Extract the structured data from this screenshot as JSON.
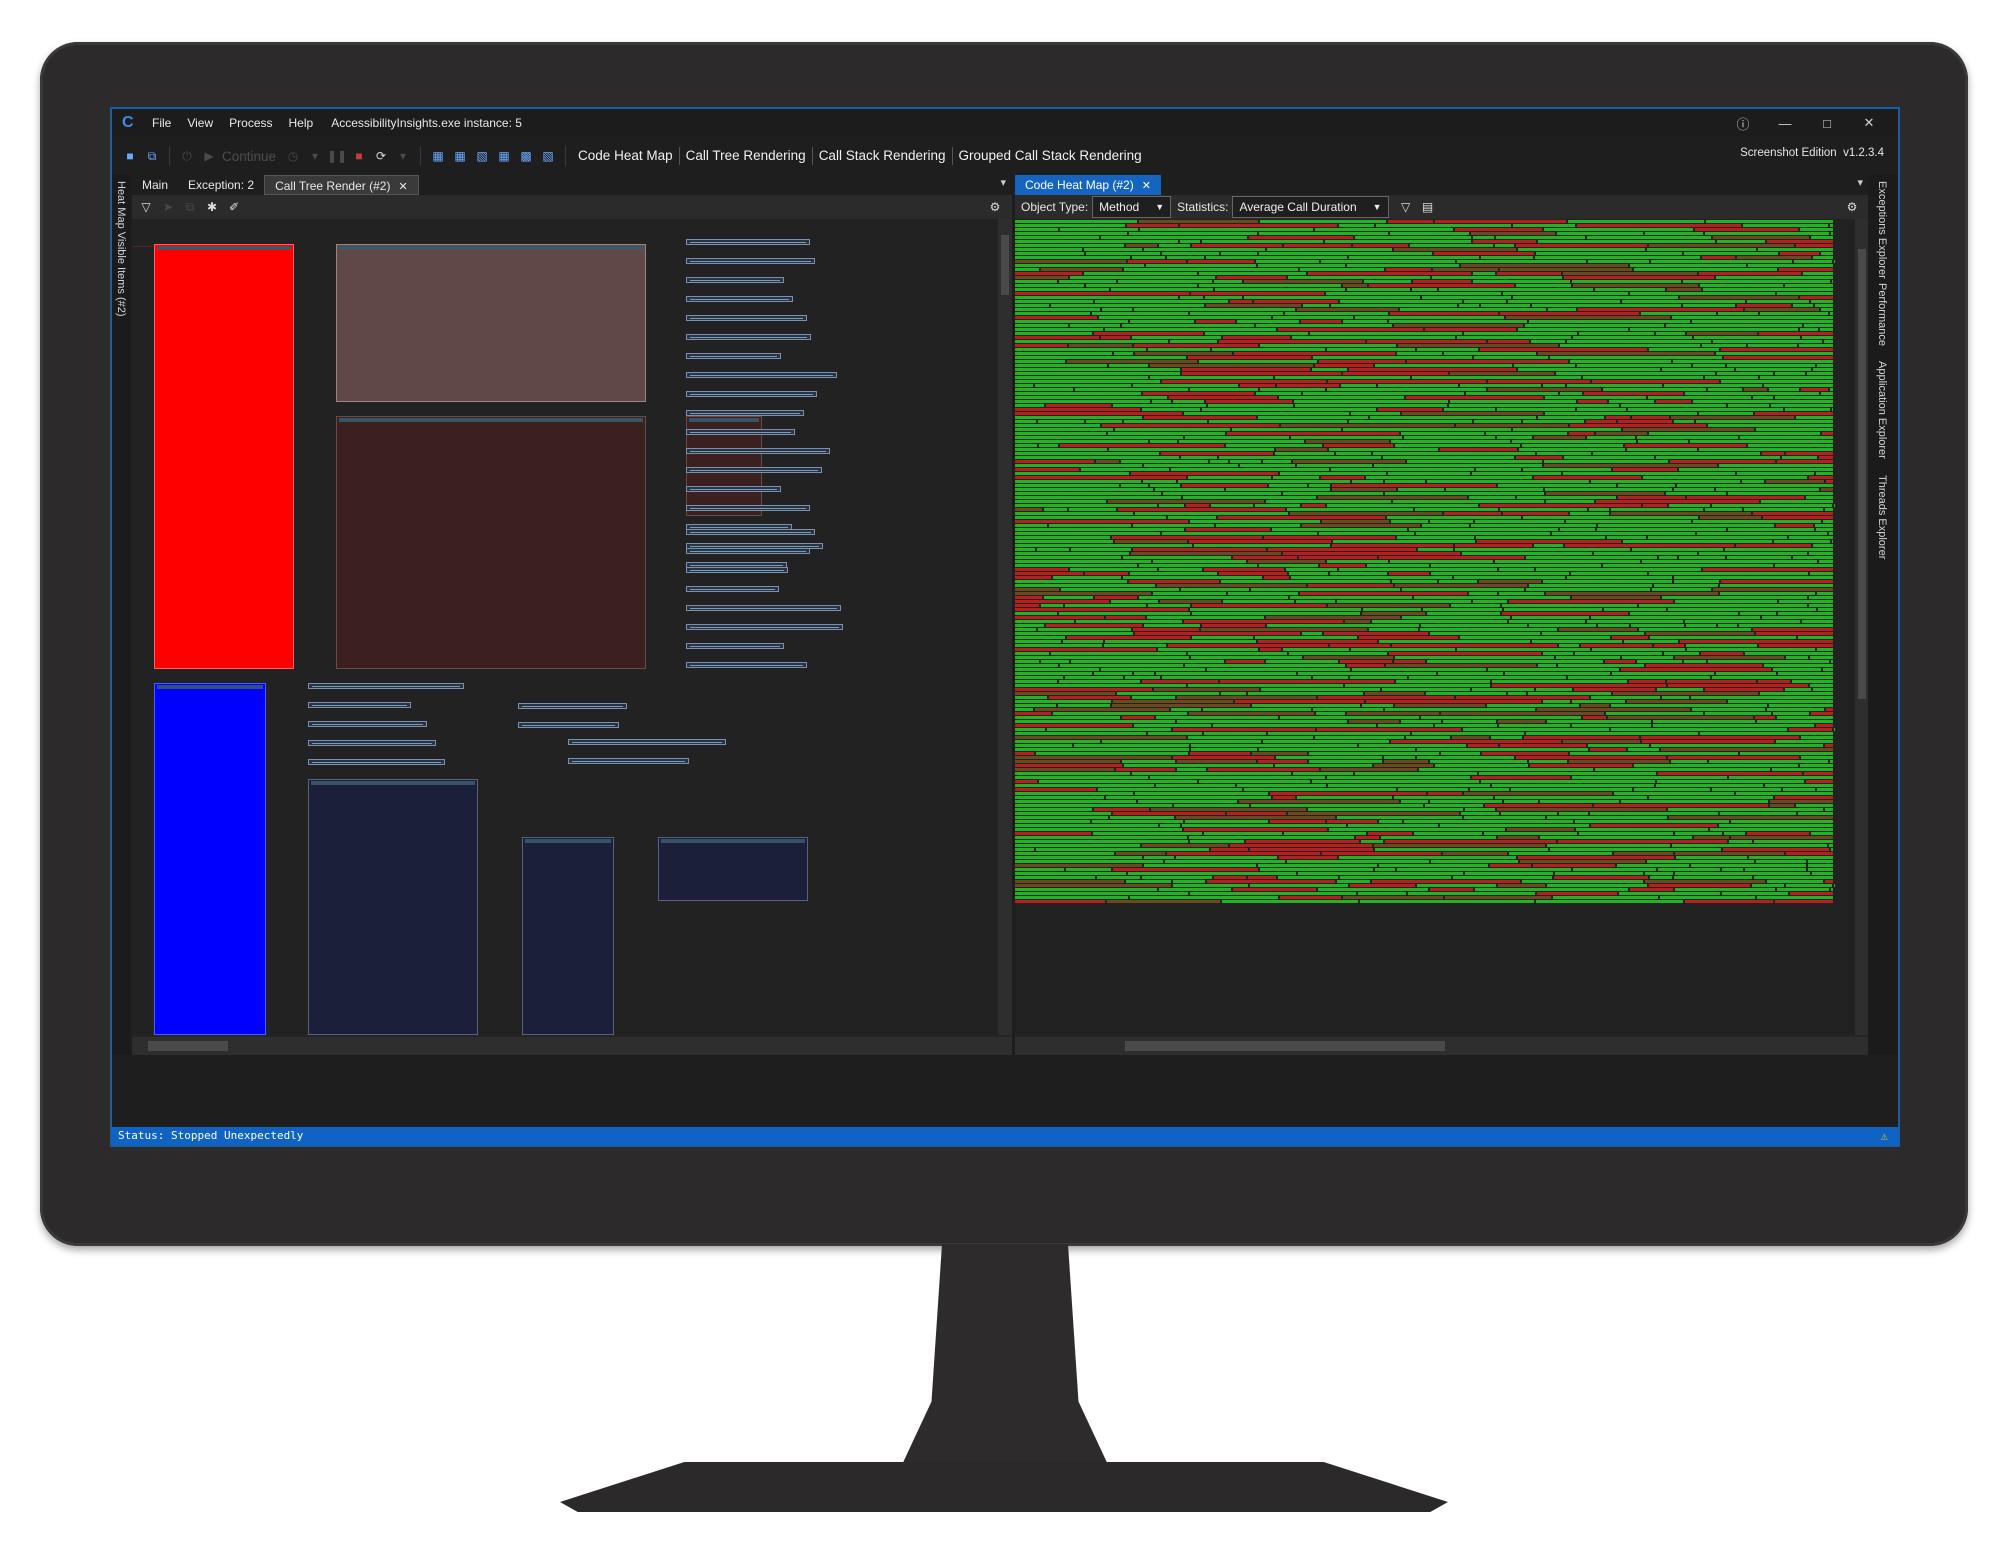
{
  "app": {
    "window_title": "AccessibilityInsights.exe instance: 5",
    "edition": "Screenshot Edition",
    "version": "v1.2.3.4",
    "menu": [
      "File",
      "View",
      "Process",
      "Help"
    ]
  },
  "toolbar": {
    "continue_label": "Continue",
    "links": [
      "Code Heat Map",
      "Call Tree Rendering",
      "Call Stack Rendering",
      "Grouped Call Stack Rendering"
    ]
  },
  "left_strip": {
    "label": "Heat Map Visible Items (#2)"
  },
  "left_pane": {
    "tabs": [
      "Main",
      "Exception: 2",
      "Call Tree Render (#2)"
    ],
    "active_tab": "Call Tree Render (#2)"
  },
  "right_pane": {
    "tab": "Code Heat Map (#2)",
    "object_type_label": "Object Type:",
    "object_type_value": "Method",
    "statistics_label": "Statistics:",
    "statistics_value": "Average Call Duration"
  },
  "right_strip": {
    "items": [
      "Exceptions Explorer",
      "Performance",
      "Application Explorer",
      "Threads Explorer"
    ]
  },
  "status": {
    "text": "Status: Stopped Unexpectedly"
  },
  "colors": {
    "accent": "#1565c0",
    "heat_green": "#22b322",
    "heat_red": "#b82020",
    "heat_dark": "#6a4a1e",
    "node_red": "#ff0000",
    "node_blue": "#0000ff",
    "node_rose": "#614848",
    "node_maroon": "#3b2020",
    "node_navy": "#1c1f3a"
  },
  "icons": [
    "save-icon",
    "save-all-icon",
    "power-icon",
    "play-icon",
    "speed-icon",
    "pause-icon",
    "stop-icon",
    "snapshot-icon",
    "filter-icon",
    "settings-icon",
    "close-icon",
    "dropdown-icon",
    "help-icon",
    "minimize-icon",
    "maximize-icon",
    "warning-icon"
  ]
}
